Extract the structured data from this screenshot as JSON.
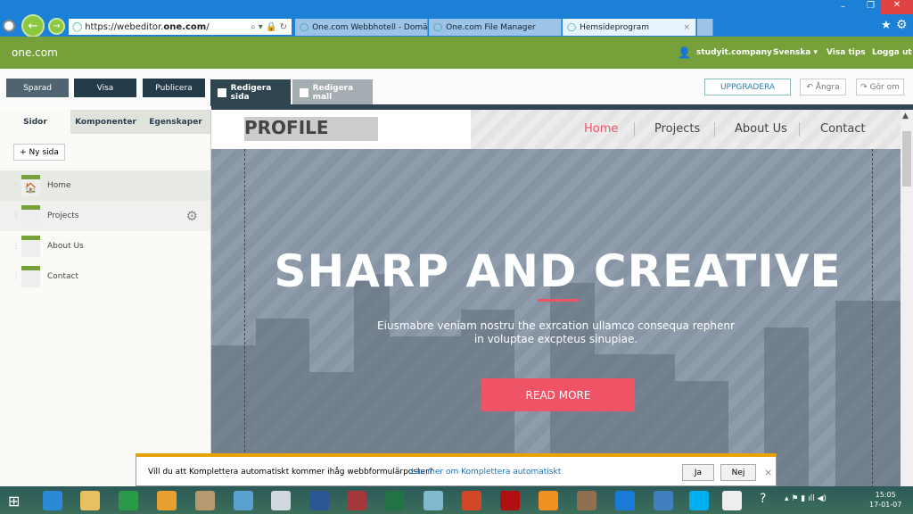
{
  "browser": {
    "url_prefix": "https://webeditor.",
    "url_domain": "one.com",
    "url_suffix": "/",
    "tabs": [
      {
        "label": "One.com Webbhotell - Domä..."
      },
      {
        "label": "One.com File Manager"
      },
      {
        "label": "Hemsideprogram"
      }
    ],
    "close_tab": "×"
  },
  "app": {
    "logo": "one.com",
    "user": "studyit.company",
    "language": "Svenska",
    "tips": "Visa tips",
    "logout": "Logga ut"
  },
  "toolbar": {
    "saved": "Sparad",
    "view": "Visa",
    "publish": "Publicera",
    "edit_page": "Redigera sida",
    "edit_template": "Redigera mall",
    "upgrade": "UPPGRADERA",
    "undo": "↶ Ångra",
    "redo": "↷ Gör om"
  },
  "sidebar": {
    "tabs": [
      "Sidor",
      "Komponenter",
      "Egenskaper"
    ],
    "new_page": "+ Ny sida",
    "pages": [
      "Home",
      "Projects",
      "About Us",
      "Contact"
    ]
  },
  "site": {
    "logo": "PROFILE",
    "nav": [
      "Home",
      "Projects",
      "About Us",
      "Contact"
    ],
    "active_nav": "Home",
    "hero_title": "SHARP AND CREATIVE",
    "hero_text1": "Eiusmabre veniam nostru the exrcation ullamco consequa rephenr",
    "hero_text2": "in voluptae excpteus sinupiae.",
    "cta": "READ MORE",
    "accent": "#ef5366"
  },
  "notification": {
    "message": "Vill du att Komplettera automatiskt kommer ihåg webbformulärposter?",
    "link": "Läs mer om Komplettera automatiskt",
    "yes": "Ja",
    "no": "Nej",
    "close": "×"
  },
  "taskbar": {
    "time": "15:05",
    "date": "17-01-07"
  }
}
